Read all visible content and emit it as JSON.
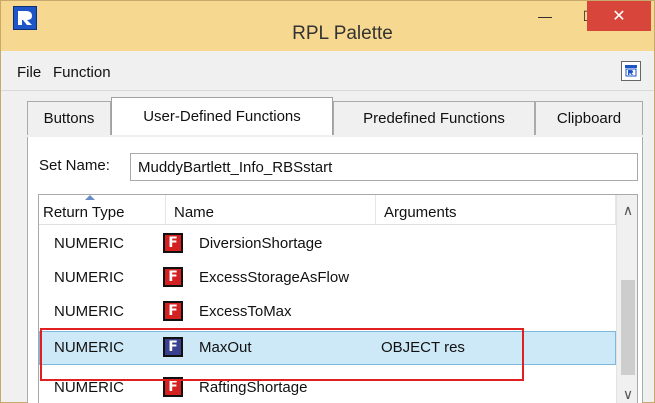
{
  "window": {
    "title": "RPL Palette",
    "accent_color": "#f6d890",
    "close_color": "#d8453b"
  },
  "menu": {
    "items": [
      "File",
      "Function"
    ]
  },
  "tabs": [
    {
      "label": "Buttons",
      "active": false
    },
    {
      "label": "User-Defined Functions",
      "active": true
    },
    {
      "label": "Predefined Functions",
      "active": false
    },
    {
      "label": "Clipboard",
      "active": false
    }
  ],
  "set_name": {
    "label": "Set Name:",
    "value": "MuddyBartlett_Info_RBSstart"
  },
  "table": {
    "columns": [
      "Return Type",
      "Name",
      "Arguments"
    ],
    "sort_column": "Return Type",
    "rows": [
      {
        "return_type": "NUMERIC",
        "name": "DiversionShortage",
        "arguments": "",
        "icon": "function-icon"
      },
      {
        "return_type": "NUMERIC",
        "name": "ExcessStorageAsFlow",
        "arguments": "",
        "icon": "function-icon"
      },
      {
        "return_type": "NUMERIC",
        "name": "ExcessToMax",
        "arguments": "",
        "icon": "function-icon"
      },
      {
        "return_type": "NUMERIC",
        "name": "MaxOut",
        "arguments": "OBJECT res",
        "icon": "function-icon",
        "selected": true
      },
      {
        "return_type": "NUMERIC",
        "name": "RaftingShortage",
        "arguments": "",
        "icon": "function-icon"
      }
    ]
  },
  "icons": {
    "app": "riverware-logo-icon",
    "minimize": "minimize-icon",
    "maximize": "maximize-icon",
    "close": "close-icon",
    "detach": "detach-palette-icon",
    "scroll_up": "chevron-up-icon",
    "scroll_down": "chevron-down-icon"
  },
  "glyphs": {
    "function": "F",
    "minimize": "—",
    "maximize": "☐",
    "close": "✕",
    "scroll_up": "∧",
    "scroll_down": "∨"
  }
}
